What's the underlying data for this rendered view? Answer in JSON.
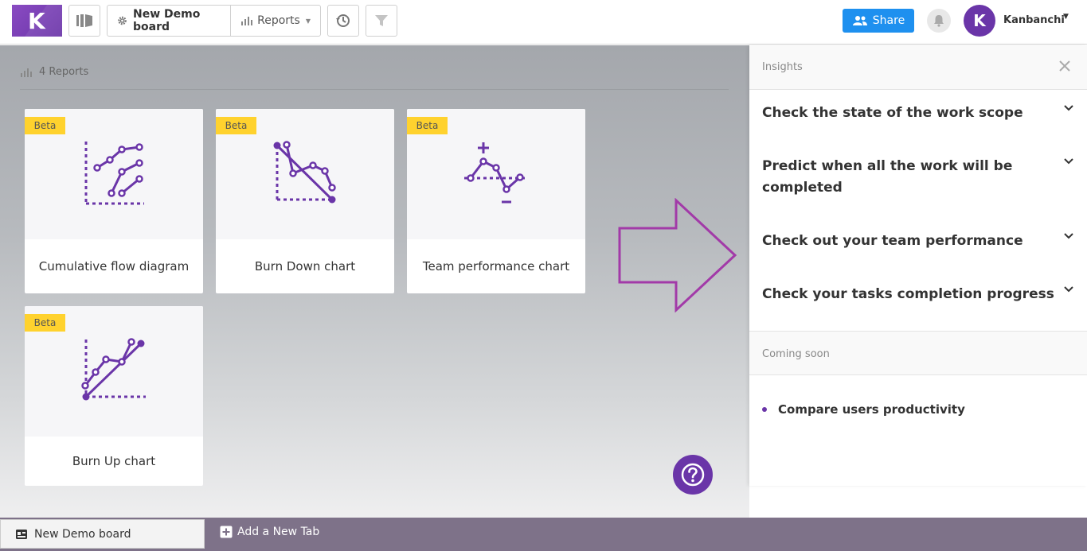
{
  "header": {
    "logo_letter": "K",
    "board_name": "New Demo board",
    "reports_label": "Reports",
    "share_label": "Share",
    "avatar_letter": "K",
    "user_name": "Kanbanchi"
  },
  "main": {
    "reports_count": "4 Reports",
    "cards": [
      {
        "badge": "Beta",
        "title": "Cumulative flow diagram"
      },
      {
        "badge": "Beta",
        "title": "Burn Down chart"
      },
      {
        "badge": "Beta",
        "title": "Team performance chart"
      },
      {
        "badge": "Beta",
        "title": "Burn Up chart"
      }
    ]
  },
  "panel": {
    "title": "Insights",
    "insights": [
      "Check the state of the work scope",
      "Predict when all the work will be completed",
      "Check out your team performance",
      "Check your tasks completion progress"
    ],
    "coming_soon_label": "Coming soon",
    "coming_soon_items": [
      "Compare users productivity"
    ]
  },
  "tabs": {
    "active_tab": "New Demo board",
    "add_tab": "Add a New Tab"
  },
  "colors": {
    "brand_purple": "#6a35a8",
    "share_blue": "#1e90ef",
    "beta_yellow": "#ffd22e",
    "arrow_magenta": "#a23aa8"
  }
}
